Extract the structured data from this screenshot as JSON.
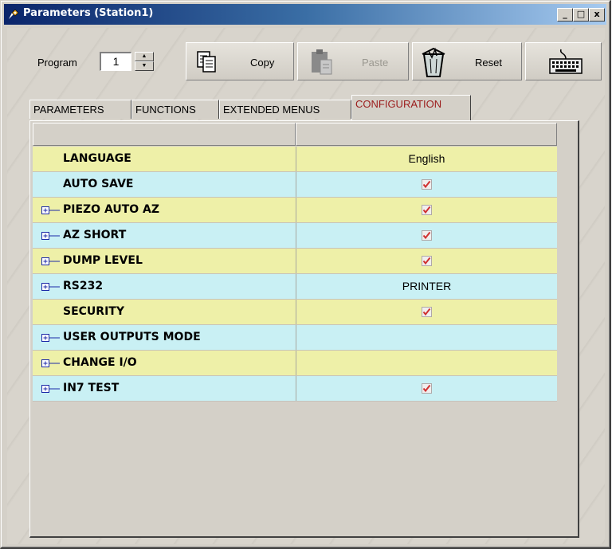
{
  "window": {
    "title": "Parameters (Station1)",
    "minimize": "_",
    "maximize": "□",
    "close": "x"
  },
  "toolbar": {
    "program_label": "Program",
    "program_value": "1",
    "copy_label": "Copy",
    "paste_label": "Paste",
    "reset_label": "Reset",
    "keyboard_icon": "keyboard-icon"
  },
  "tabs": [
    {
      "label": "PARAMETERS",
      "active": false
    },
    {
      "label": "FUNCTIONS",
      "active": false
    },
    {
      "label": "EXTENDED MENUS",
      "active": false
    },
    {
      "label": "CONFIGURATION",
      "active": true
    }
  ],
  "colors": {
    "row_yellow": "#eef0a8",
    "row_cyan": "#c9f0f4",
    "active_tab_text": "#9b1c1c",
    "check": "#d03030"
  },
  "rows": [
    {
      "name": "LANGUAGE",
      "value": "English",
      "checked": false,
      "expandable": false
    },
    {
      "name": "AUTO SAVE",
      "value": "",
      "checked": true,
      "expandable": false
    },
    {
      "name": "PIEZO AUTO AZ",
      "value": "",
      "checked": true,
      "expandable": true
    },
    {
      "name": "AZ SHORT",
      "value": "",
      "checked": true,
      "expandable": true
    },
    {
      "name": "DUMP LEVEL",
      "value": "",
      "checked": true,
      "expandable": true
    },
    {
      "name": "RS232",
      "value": "PRINTER",
      "checked": false,
      "expandable": true
    },
    {
      "name": "SECURITY",
      "value": "",
      "checked": true,
      "expandable": false
    },
    {
      "name": "USER OUTPUTS MODE",
      "value": "",
      "checked": false,
      "expandable": true
    },
    {
      "name": "CHANGE I/O",
      "value": "",
      "checked": false,
      "expandable": true
    },
    {
      "name": "IN7 TEST",
      "value": "",
      "checked": true,
      "expandable": true
    }
  ]
}
